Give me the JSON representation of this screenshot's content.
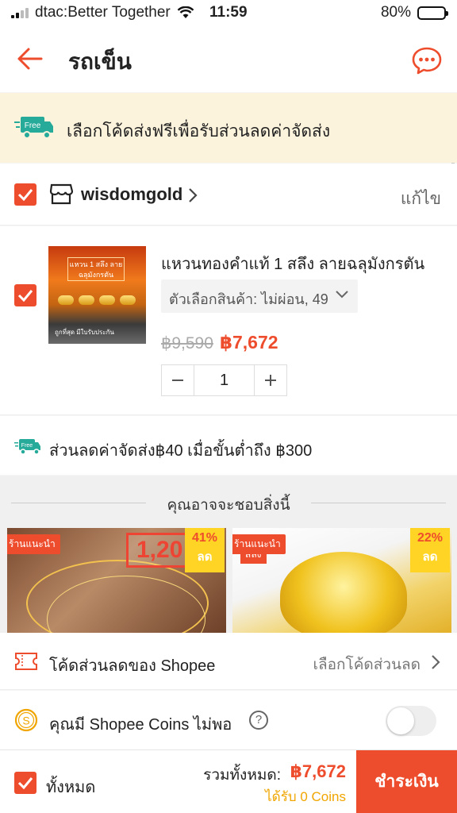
{
  "status_bar": {
    "carrier": "dtac:Better Together",
    "time": "11:59",
    "battery": "80%"
  },
  "header": {
    "title": "รถเข็น"
  },
  "free_banner": {
    "badge": "Free",
    "text": "เลือกโค้ดส่งฟรีเพื่อรับส่วนลดค่าจัดส่ง"
  },
  "shop": {
    "name": "wisdomgold",
    "edit_label": "แก้ไข"
  },
  "product": {
    "name": "แหวนทองคำแท้ 1 สลึง ลายฉลุมังกรตัน",
    "variant": "ตัวเลือกสินค้า: ไม่ผ่อน, 49",
    "old_price": "฿9,590",
    "price": "฿7,672",
    "quantity": "1",
    "image_tag": "แหวน 1 สลึง ลายฉลุมังกรตัน",
    "image_caption": "ถูกที่สุด มีใบรับประกัน"
  },
  "shipping_discount": {
    "badge": "Free",
    "text": "ส่วนลดค่าจัดส่ง฿40 เมื่อขั้นต่ำถึง ฿300"
  },
  "recommendations": {
    "title": "คุณอาจจะชอบสิ่งนี้",
    "cards": [
      {
        "shop_badge": "ร้านแนะนำ",
        "discount": "41%",
        "discount_label": "ลด",
        "price_text": "1,20"
      },
      {
        "shop_badge": "ร้านแนะนำ",
        "discount": "22%",
        "discount_label": "ลด",
        "weight_text": "สลึง"
      }
    ]
  },
  "voucher": {
    "label": "โค้ดส่วนลดของ Shopee",
    "select_label": "เลือกโค้ดส่วนลด"
  },
  "coins": {
    "label": "คุณมี Shopee Coins ไม่พอ",
    "help": "?",
    "enabled": false
  },
  "footer": {
    "all_label": "ทั้งหมด",
    "total_label": "รวมทั้งหมด:",
    "total_value": "฿7,672",
    "earn_text": "ได้รับ 0  Coins",
    "checkout_label": "ชำระเงิน"
  },
  "colors": {
    "accent": "#ee4d2d",
    "banner_bg": "#fcf3dd",
    "coins": "#f0a500",
    "free_green": "#26aa99"
  }
}
